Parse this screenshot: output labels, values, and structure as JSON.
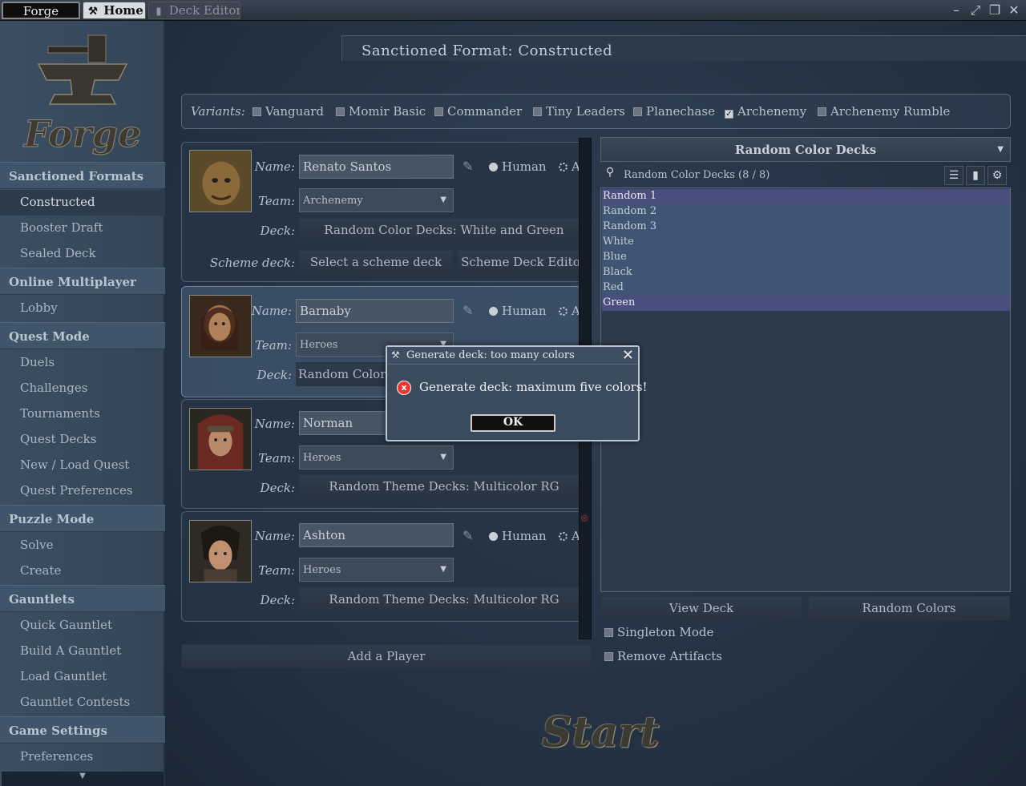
{
  "titlebar": {
    "tabs": [
      {
        "label": "Forge"
      },
      {
        "label": "Home"
      },
      {
        "label": "Deck Editor"
      }
    ]
  },
  "sidebar": {
    "logo_text": "Forge",
    "sections": [
      {
        "header": "Sanctioned Formats",
        "items": [
          "Constructed",
          "Booster Draft",
          "Sealed Deck"
        ]
      },
      {
        "header": "Online Multiplayer",
        "items": [
          "Lobby"
        ]
      },
      {
        "header": "Quest Mode",
        "items": [
          "Duels",
          "Challenges",
          "Tournaments",
          "Quest Decks",
          "New / Load Quest",
          "Quest Preferences"
        ]
      },
      {
        "header": "Puzzle Mode",
        "items": [
          "Solve",
          "Create"
        ]
      },
      {
        "header": "Gauntlets",
        "items": [
          "Quick Gauntlet",
          "Build A Gauntlet",
          "Load Gauntlet",
          "Gauntlet Contests"
        ]
      },
      {
        "header": "Game Settings",
        "items": [
          "Preferences"
        ]
      }
    ],
    "active_item": "Constructed"
  },
  "main": {
    "sanctioned_title": "Sanctioned Format: Constructed",
    "variants_label": "Variants:",
    "variants": [
      {
        "label": "Vanguard",
        "checked": false
      },
      {
        "label": "Momir Basic",
        "checked": false
      },
      {
        "label": "Commander",
        "checked": false
      },
      {
        "label": "Tiny Leaders",
        "checked": false
      },
      {
        "label": "Planechase",
        "checked": false
      },
      {
        "label": "Archenemy",
        "checked": true
      },
      {
        "label": "Archenemy Rumble",
        "checked": false
      }
    ],
    "labels": {
      "name": "Name:",
      "team": "Team:",
      "deck": "Deck:",
      "scheme_deck": "Scheme deck:",
      "human": "Human",
      "ai": "AI"
    },
    "players": [
      {
        "name": "Renato Santos",
        "team": "Archenemy",
        "deck": "Random Color Decks: White and Green",
        "scheme_button": "Select a scheme deck",
        "scheme_editor": "Scheme Deck Editor"
      },
      {
        "name": "Barnaby",
        "team": "Heroes",
        "deck": "Random Color D"
      },
      {
        "name": "Norman",
        "team": "Heroes",
        "deck": "Random Theme Decks: Multicolor RG"
      },
      {
        "name": "Ashton",
        "team": "Heroes",
        "deck": "Random Theme Decks: Multicolor RG"
      }
    ],
    "add_player": "Add a Player",
    "start": "Start"
  },
  "deck_panel": {
    "type": "Random Color Decks",
    "count_label": "Random Color Decks (8 / 8)",
    "decks": [
      "Random 1",
      "Random 2",
      "Random 3",
      "White",
      "Blue",
      "Black",
      "Red",
      "Green"
    ],
    "selected": [
      "Random 1",
      "Green"
    ],
    "view_deck": "View Deck",
    "random_colors": "Random Colors",
    "singleton": "Singleton Mode",
    "remove_artifacts": "Remove Artifacts"
  },
  "dialog": {
    "title": "Generate deck: too many colors",
    "message": "Generate deck: maximum five colors!",
    "ok": "OK"
  }
}
